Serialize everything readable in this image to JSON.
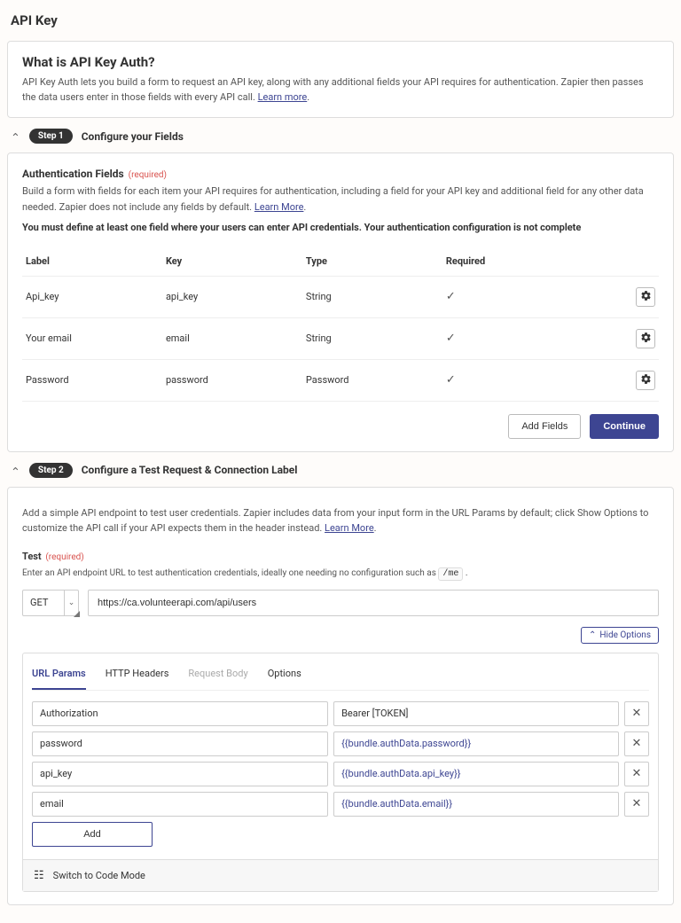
{
  "page_title": "API Key",
  "intro": {
    "title": "What is API Key Auth?",
    "text": "API Key Auth lets you build a form to request an API key, along with any additional fields your API requires for authentication. Zapier then passes the data users enter in those fields with every API call.",
    "learn_more": "Learn more"
  },
  "step1": {
    "pill": "Step 1",
    "title": "Configure your Fields",
    "auth_heading": "Authentication Fields",
    "required_label": "(required)",
    "desc1": "Build a form with fields for each item your API requires for authentication, including a field for your API key and additional field for any other data needed. Zapier does not include any fields by default.",
    "learn_more": "Learn More",
    "desc2": "You must define at least one field where your users can enter API credentials. Your authentication configuration is not complete",
    "columns": {
      "label": "Label",
      "key": "Key",
      "type": "Type",
      "required": "Required"
    },
    "fields": [
      {
        "label": "Api_key",
        "key": "api_key",
        "type": "String",
        "required": true
      },
      {
        "label": "Your email",
        "key": "email",
        "type": "String",
        "required": true
      },
      {
        "label": "Password",
        "key": "password",
        "type": "Password",
        "required": true
      }
    ],
    "add_fields": "Add Fields",
    "continue": "Continue"
  },
  "step2": {
    "pill": "Step 2",
    "title": "Configure a Test Request & Connection Label",
    "desc": "Add a simple API endpoint to test user credentials. Zapier includes data from your input form in the URL Params by default; click Show Options to customize the API call if your API expects them in the header instead.",
    "learn_more": "Learn More",
    "test_heading": "Test",
    "required_label": "(required)",
    "test_desc_pre": "Enter an API endpoint URL to test authentication credentials, ideally one needing no configuration such as",
    "test_desc_chip": "/me",
    "method": "GET",
    "url": "https://ca.volunteerapi.com/api/users",
    "hide_options": "Hide Options",
    "tabs": {
      "url_params": "URL Params",
      "http_headers": "HTTP Headers",
      "request_body": "Request Body",
      "options": "Options"
    },
    "params": [
      {
        "key": "Authorization",
        "value": "Bearer [TOKEN]",
        "plain": true
      },
      {
        "key": "password",
        "value": "{{bundle.authData.password}}"
      },
      {
        "key": "api_key",
        "value": "{{bundle.authData.api_key}}"
      },
      {
        "key": "email",
        "value": "{{bundle.authData.email}}"
      }
    ],
    "add": "Add",
    "switch_code": "Switch to Code Mode"
  }
}
